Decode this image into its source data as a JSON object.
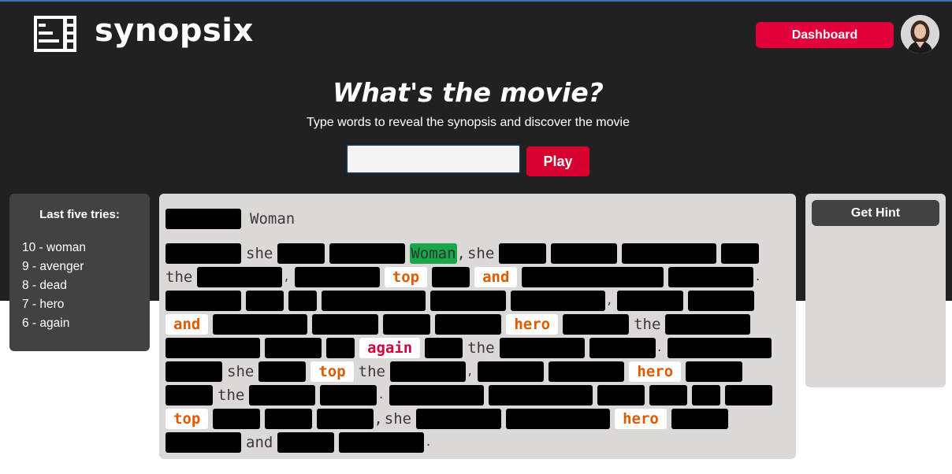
{
  "app": {
    "name": "synopsix"
  },
  "header": {
    "dashboard_label": "Dashboard",
    "title": "What's the movie?",
    "subtitle": "Type words to reveal the synopsis and discover the movie",
    "input_value": "",
    "play_label": "Play"
  },
  "tries": {
    "title": "Last five tries:",
    "items": [
      "10 - woman",
      "9 - avenger",
      "8 - dead",
      "7 - hero",
      "6 - again"
    ]
  },
  "synopsis": {
    "title_word": "Woman",
    "words": {
      "she": "she",
      "woman": "Woman",
      "the": "the",
      "top": "top",
      "and": "and",
      "hero": "hero",
      "again": "again",
      "comma": ",",
      "period": "."
    }
  },
  "hint": {
    "label": "Get Hint"
  },
  "colors": {
    "header_bg": "#212121",
    "accent": "#e4003a",
    "panel_bg": "#dcd8d8",
    "tries_bg": "#424242",
    "found_word_bg": "#18a84a",
    "revealed_word_text": "#e05a00"
  },
  "icons": {
    "logo": "film-strip-icon",
    "avatar": "user-avatar"
  }
}
